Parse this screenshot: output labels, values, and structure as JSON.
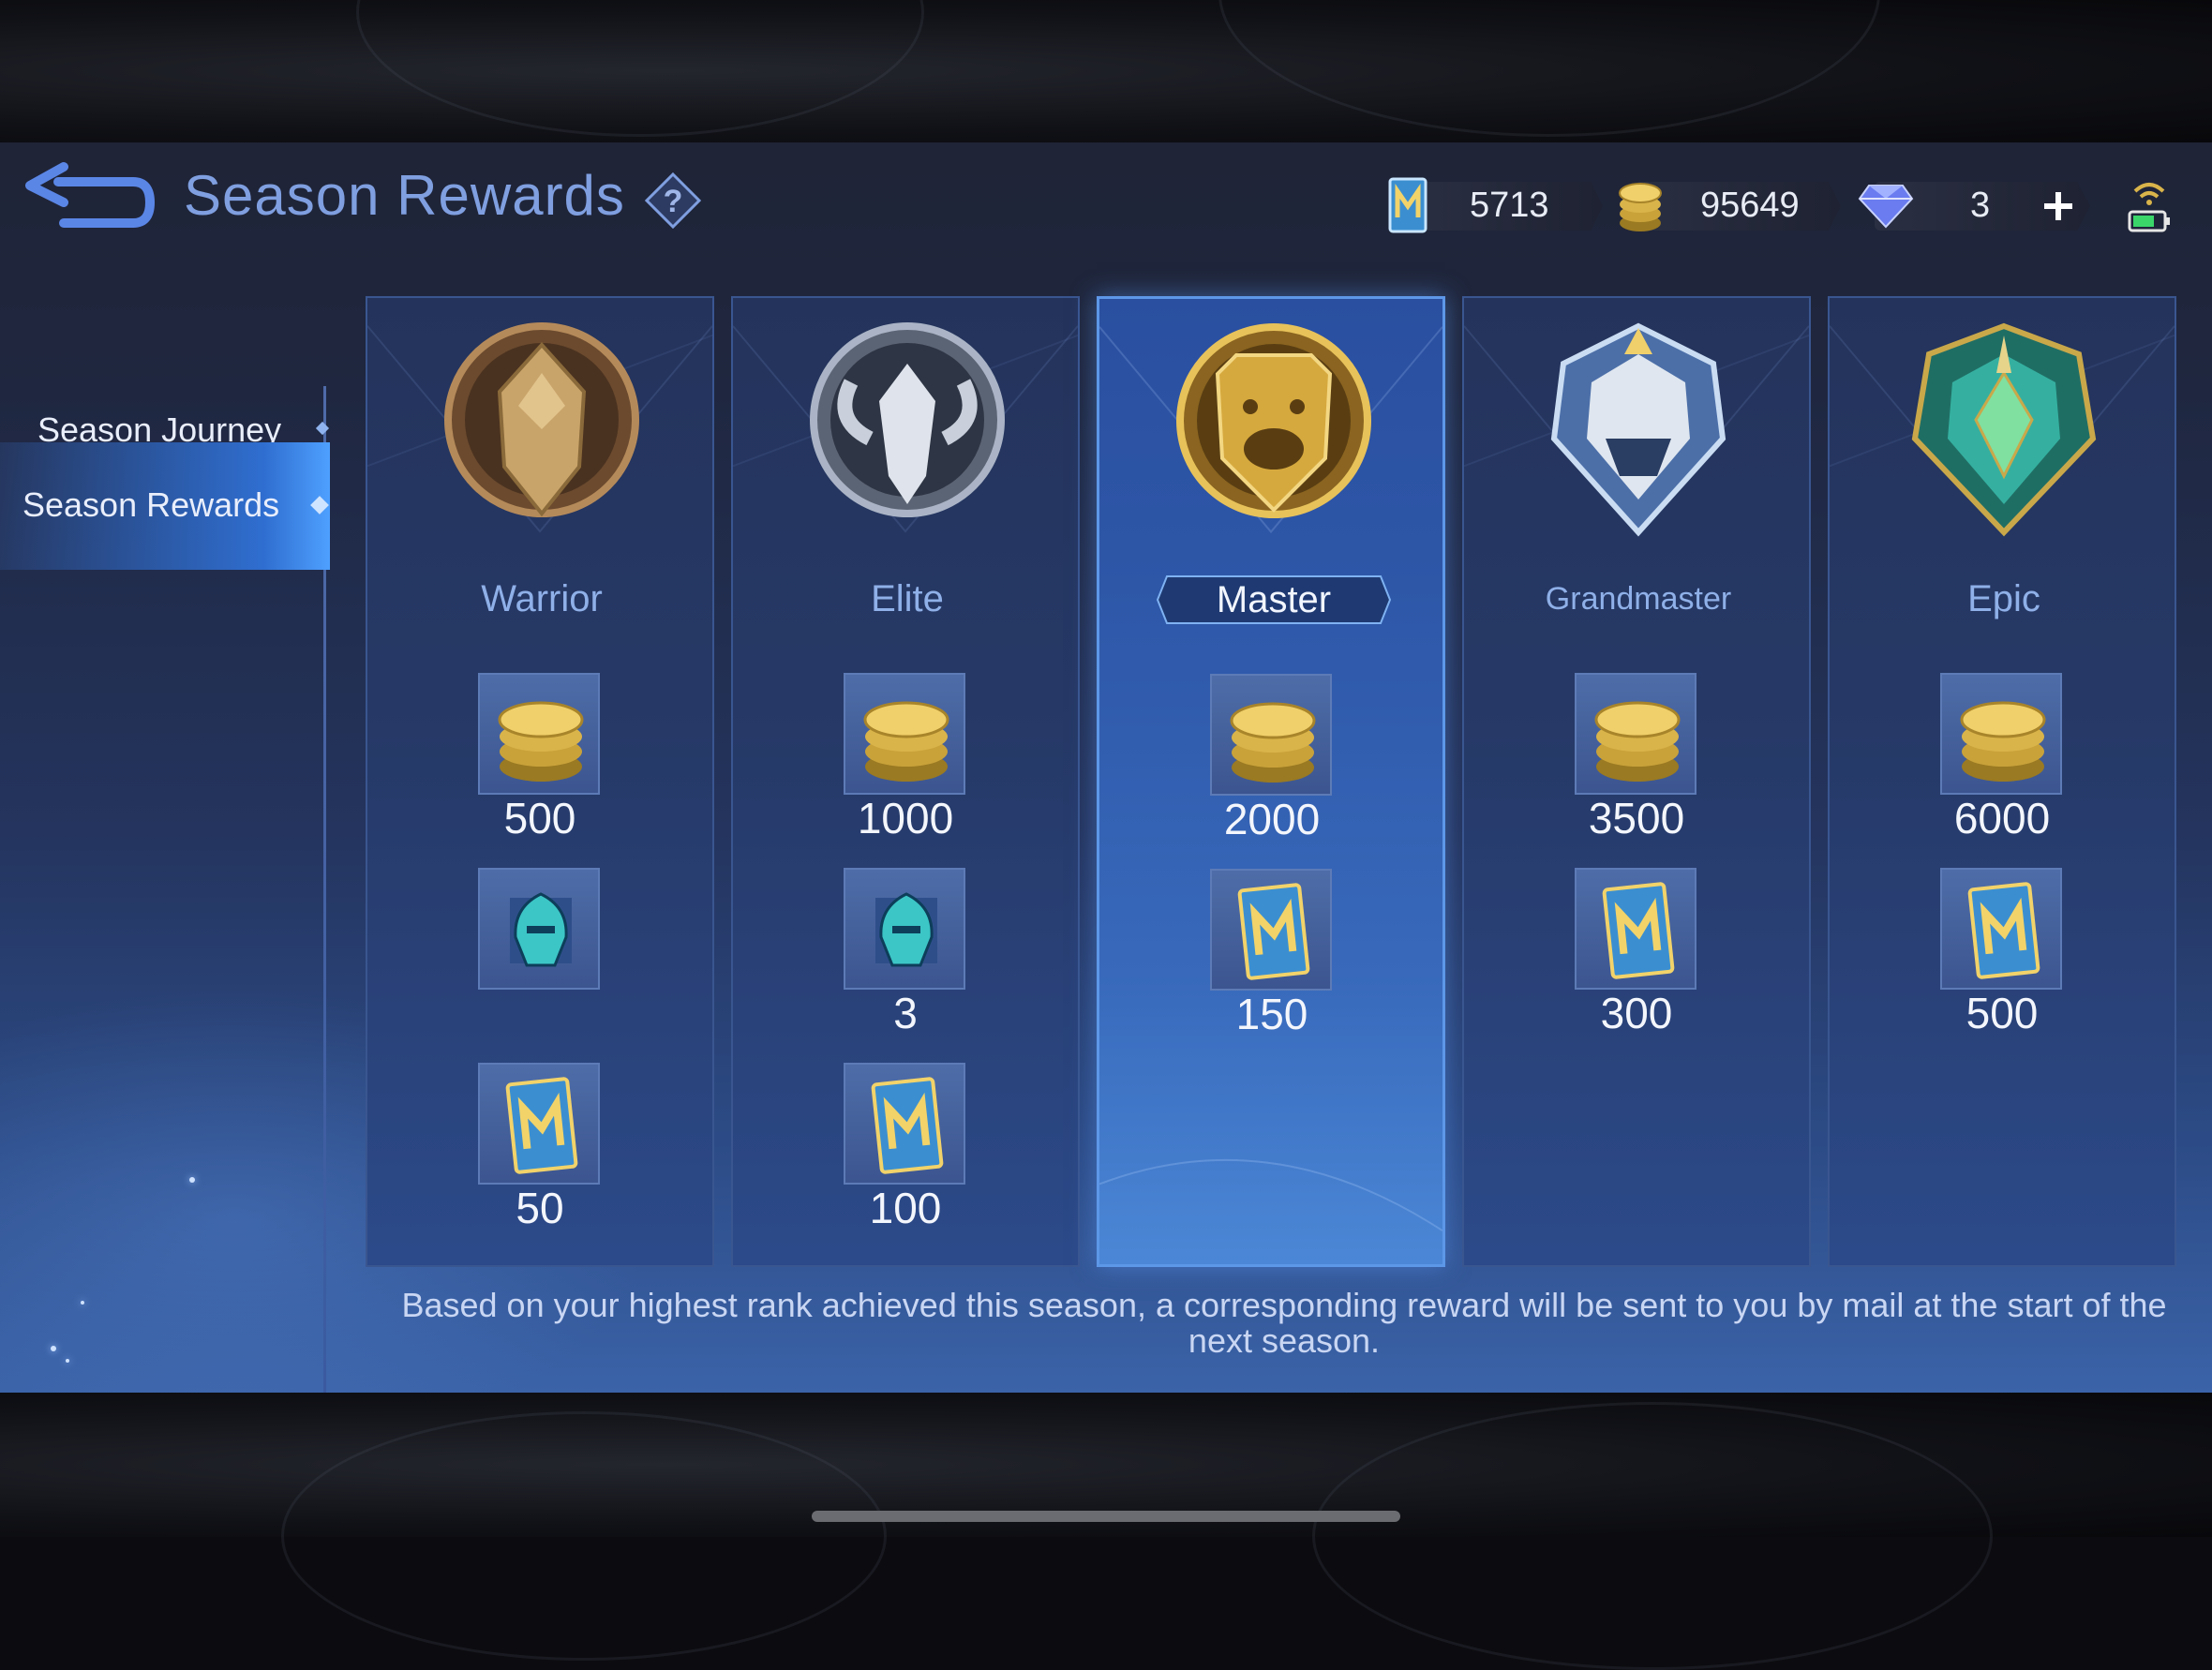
{
  "header": {
    "title": "Season Rewards",
    "back_icon": "back-arrow-icon",
    "help_icon": "question-icon"
  },
  "currencies": {
    "tickets": "5713",
    "battle_points": "95649",
    "diamonds": "3"
  },
  "sidebar": {
    "items": [
      {
        "label": "Season Journey",
        "active": false
      },
      {
        "label": "Season Rewards",
        "active": true
      }
    ]
  },
  "ranks": [
    {
      "name": "Warrior",
      "coins": "500",
      "fragment": "",
      "tickets": "50",
      "highlight": false
    },
    {
      "name": "Elite",
      "coins": "1000",
      "fragment": "3",
      "tickets": "100",
      "highlight": false
    },
    {
      "name": "Master",
      "coins": "2000",
      "tickets": "150",
      "highlight": true
    },
    {
      "name": "Grandmaster",
      "coins": "3500",
      "tickets": "300",
      "highlight": false
    },
    {
      "name": "Epic",
      "coins": "6000",
      "tickets": "500",
      "highlight": false
    }
  ],
  "footnote": "Based on your highest rank achieved this season, a corresponding reward will be sent to you by mail at the start of the next season.",
  "colors": {
    "accent": "#7f9fe0",
    "highlight_border": "#5d97e8",
    "gold": "#d9b44a"
  }
}
